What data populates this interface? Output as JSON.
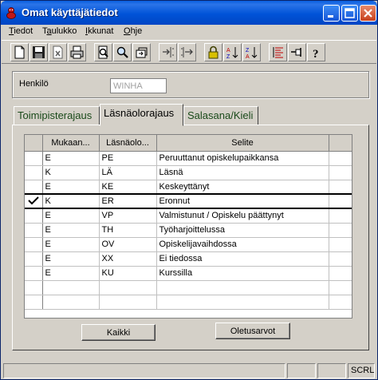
{
  "window": {
    "title": "Omat käyttäjätiedot"
  },
  "menu": [
    {
      "label": "Tiedot",
      "accel": "T",
      "rest": "iedot"
    },
    {
      "label": "Taulukko",
      "accel": "a",
      "before": "T",
      "rest": "ulukko"
    },
    {
      "label": "Ikkunat",
      "accel": "I",
      "rest": "kkunat"
    },
    {
      "label": "Ohje",
      "accel": "O",
      "rest": "hje"
    }
  ],
  "toolbar_icons": [
    "new-icon",
    "save-icon",
    "delete-icon",
    "print-icon",
    "print-preview-icon",
    "search-icon",
    "find-record-icon",
    "import-icon",
    "export-icon",
    "lock-icon",
    "sort-ascending-icon",
    "sort-descending-icon",
    "list-icon",
    "pin-icon",
    "help-icon"
  ],
  "person": {
    "label": "Henkilö",
    "value": "WINHA"
  },
  "tabs": [
    "Toimipisterajaus",
    "Läsnäolorajaus",
    "Salasana/Kieli"
  ],
  "active_tab": "Läsnäolorajaus",
  "grid": {
    "columns": [
      "Mukaan...",
      "Läsnäolo...",
      "Selite"
    ],
    "rows": [
      {
        "mukaan": "E",
        "lasnaolo": "PE",
        "selite": "Peruuttanut opiskelupaikkansa",
        "selected": false
      },
      {
        "mukaan": "K",
        "lasnaolo": "LÄ",
        "selite": "Läsnä",
        "selected": false
      },
      {
        "mukaan": "E",
        "lasnaolo": "KE",
        "selite": "Keskeyttänyt",
        "selected": false
      },
      {
        "mukaan": "K",
        "lasnaolo": "ER",
        "selite": "Eronnut",
        "selected": true
      },
      {
        "mukaan": "E",
        "lasnaolo": "VP",
        "selite": "Valmistunut / Opiskelu päättynyt",
        "selected": false
      },
      {
        "mukaan": "E",
        "lasnaolo": "TH",
        "selite": "Työharjoittelussa",
        "selected": false
      },
      {
        "mukaan": "E",
        "lasnaolo": "OV",
        "selite": "Opiskelijavaihdossa",
        "selected": false
      },
      {
        "mukaan": "E",
        "lasnaolo": "XX",
        "selite": "Ei tiedossa",
        "selected": false
      },
      {
        "mukaan": "E",
        "lasnaolo": "KU",
        "selite": "Kurssilla",
        "selected": false
      }
    ]
  },
  "buttons": {
    "all": "Kaikki",
    "defaults": "Oletusarvot"
  },
  "status": {
    "scrl": "SCRL"
  }
}
